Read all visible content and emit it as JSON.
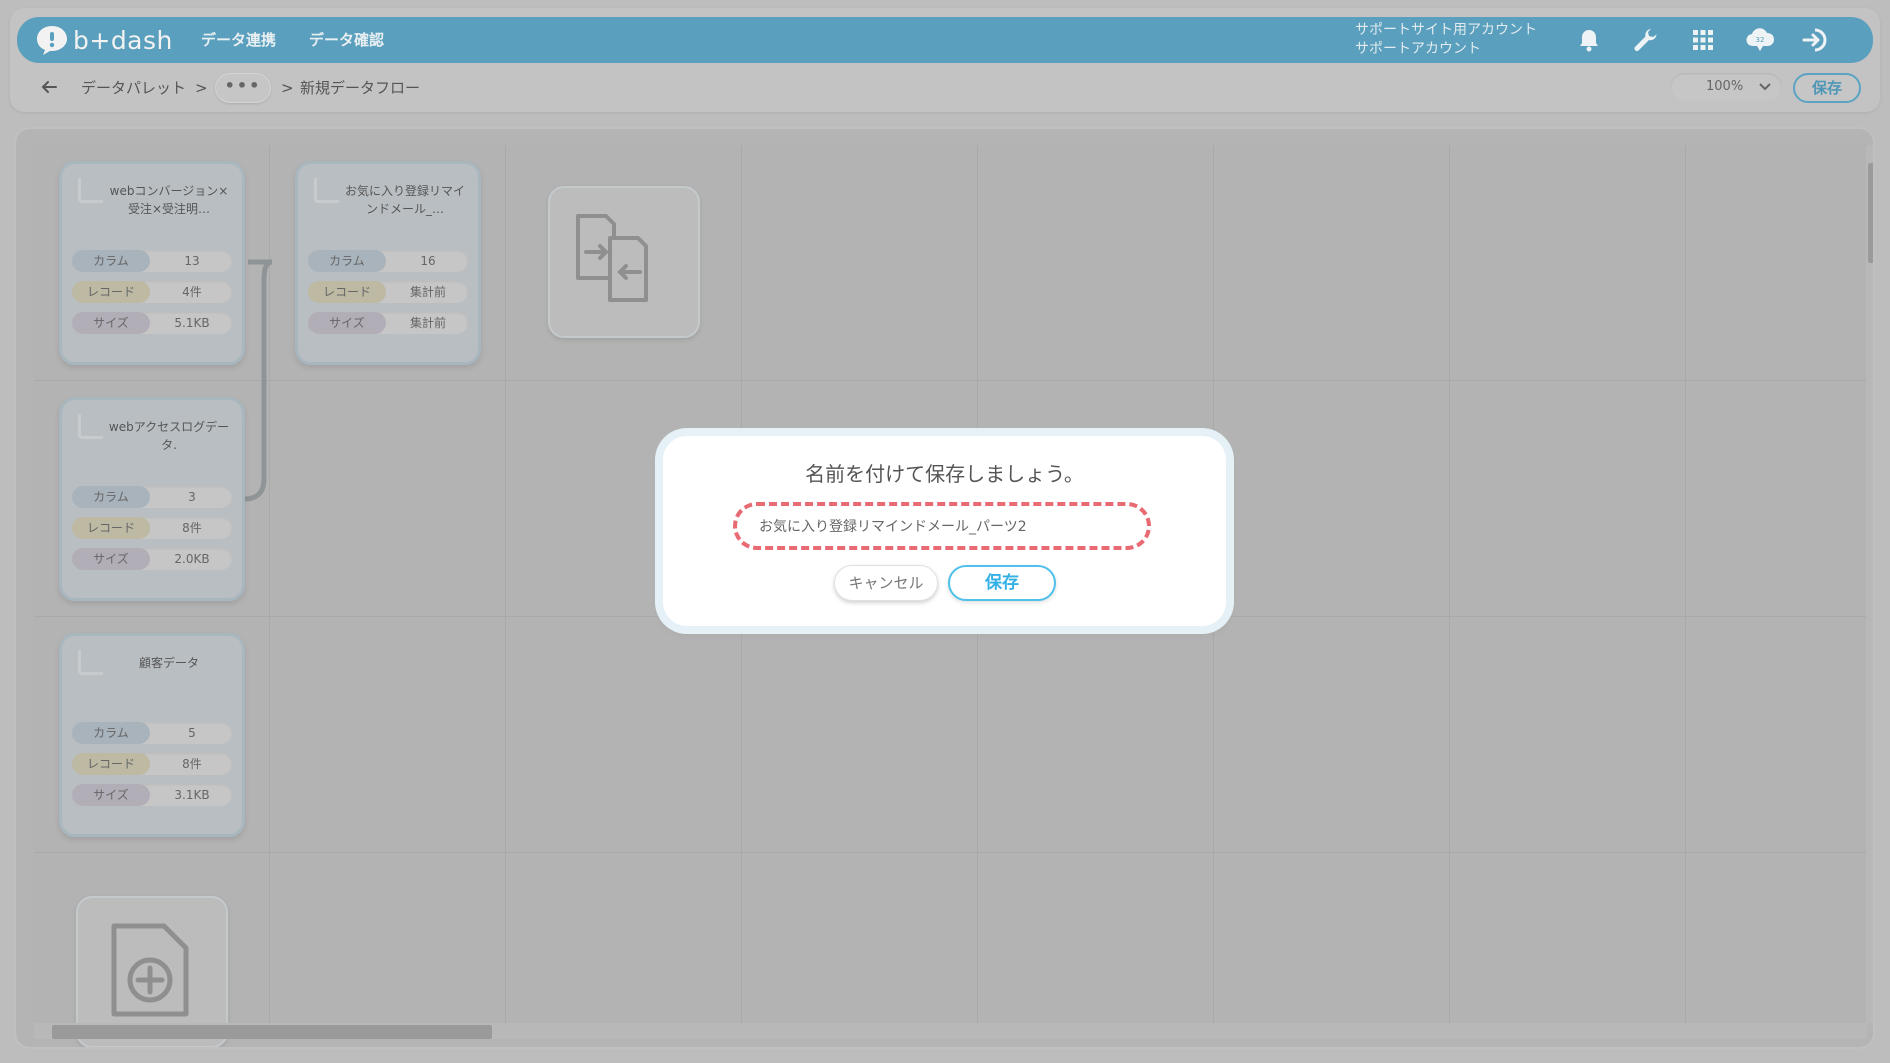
{
  "header": {
    "logo_text": "b+dash",
    "nav": [
      "データ連携",
      "データ確認"
    ],
    "account_line1": "サポートサイト用アカウント",
    "account_line2": "サポートアカウント",
    "icons": [
      "bell-icon",
      "wrench-icon",
      "grid-icon",
      "notification-cloud-icon",
      "logout-icon"
    ],
    "badge": "32"
  },
  "breadcrumb": {
    "root": "データパレット",
    "sep": ">",
    "ellipsis": "•••",
    "current": "新規データフロー"
  },
  "toolbar": {
    "zoom": "100%",
    "save_label": "保存"
  },
  "labels": {
    "columns": "カラム",
    "records": "レコード",
    "size": "サイズ"
  },
  "nodes": [
    {
      "title": "webコンバージョン×受注×受注明…",
      "columns": "13",
      "records": "4件",
      "size": "5.1KB"
    },
    {
      "title": "お気に入り登録リマインドメール_…",
      "columns": "16",
      "records": "集計前",
      "size": "集計前"
    },
    {
      "title": "webアクセスログデータ.",
      "columns": "3",
      "records": "8件",
      "size": "2.0KB"
    },
    {
      "title": "顧客データ",
      "columns": "5",
      "records": "8件",
      "size": "3.1KB"
    }
  ],
  "modal": {
    "title": "名前を付けて保存しましょう。",
    "input_value": "お気に入り登録リマインドメール_パーツ2",
    "cancel_label": "キャンセル",
    "save_label": "保存"
  },
  "colors": {
    "topbar": "#5a9fbd",
    "accent": "#33b1e4",
    "highlight": "#e86a72"
  }
}
